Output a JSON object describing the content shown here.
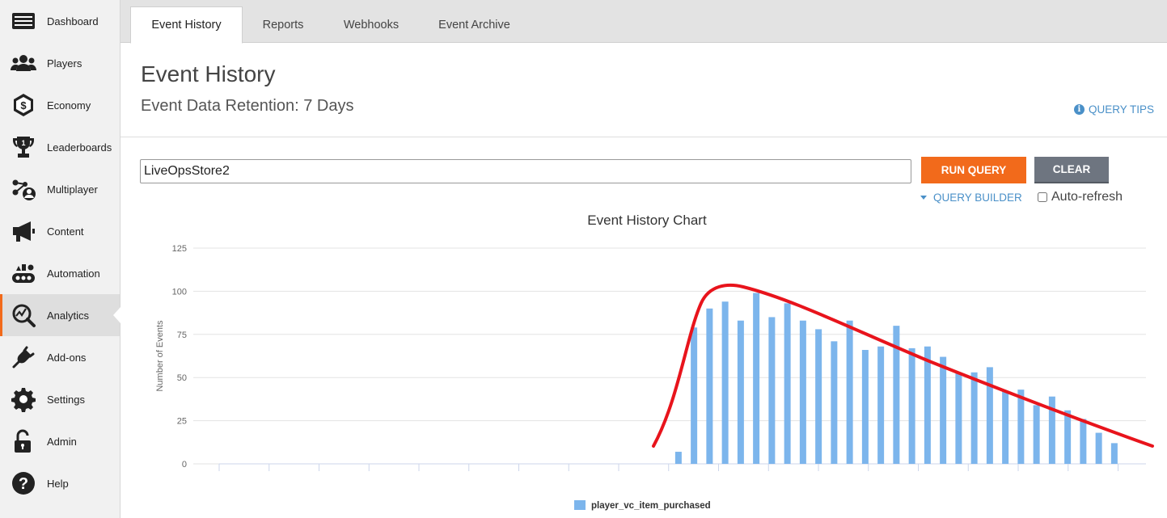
{
  "sidebar": {
    "items": [
      {
        "label": "Dashboard",
        "icon": "dashboard-icon"
      },
      {
        "label": "Players",
        "icon": "players-icon"
      },
      {
        "label": "Economy",
        "icon": "economy-icon"
      },
      {
        "label": "Leaderboards",
        "icon": "trophy-icon"
      },
      {
        "label": "Multiplayer",
        "icon": "multiplayer-icon"
      },
      {
        "label": "Content",
        "icon": "megaphone-icon"
      },
      {
        "label": "Automation",
        "icon": "automation-icon"
      },
      {
        "label": "Analytics",
        "icon": "analytics-icon",
        "active": true
      },
      {
        "label": "Add-ons",
        "icon": "plug-icon"
      },
      {
        "label": "Settings",
        "icon": "gear-icon"
      },
      {
        "label": "Admin",
        "icon": "lock-icon"
      },
      {
        "label": "Help",
        "icon": "help-icon"
      }
    ]
  },
  "tabs": [
    "Event History",
    "Reports",
    "Webhooks",
    "Event Archive"
  ],
  "header": {
    "title": "Event History",
    "retention": "Event Data Retention: 7 Days",
    "query_tips": "QUERY TIPS"
  },
  "query": {
    "value": "LiveOpsStore2",
    "run_label": "RUN QUERY",
    "clear_label": "CLEAR",
    "builder_label": "QUERY BUILDER",
    "autorefresh_label": "Auto-refresh"
  },
  "colors": {
    "accent": "#f26a1b",
    "link": "#4a90c8",
    "bar": "#7cb5ec",
    "annotation": "#e8141c"
  },
  "chart_data": {
    "type": "bar",
    "title": "Event History Chart",
    "ylabel": "Number of Events",
    "xlabel": "",
    "ylim": [
      0,
      125
    ],
    "yticks": [
      0,
      25,
      50,
      75,
      100,
      125
    ],
    "grid": true,
    "legend": "bottom-center",
    "series": [
      {
        "name": "player_vc_item_purchased",
        "values": [
          0,
          0,
          0,
          0,
          0,
          0,
          0,
          0,
          0,
          0,
          0,
          0,
          0,
          0,
          0,
          0,
          0,
          0,
          0,
          0,
          0,
          0,
          0,
          0,
          0,
          0,
          0,
          0,
          0,
          7,
          79,
          90,
          94,
          83,
          99,
          85,
          93,
          83,
          78,
          71,
          83,
          66,
          68,
          80,
          67,
          68,
          62,
          53,
          53,
          56,
          42,
          43,
          34,
          39,
          31,
          26,
          18,
          12
        ]
      }
    ],
    "annotation": "hand-drawn red trend curve over the bars"
  }
}
